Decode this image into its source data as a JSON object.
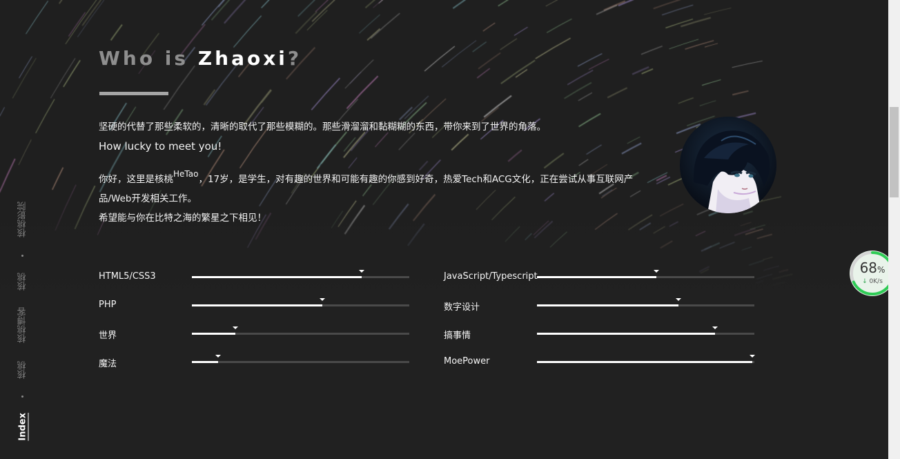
{
  "header": {
    "title_part1": "Who is ",
    "title_name": "Zhaoxi",
    "title_q": "?"
  },
  "intro": {
    "line1": "坚硬的代替了那些柔软的，清晰的取代了那些模糊的。那些滑溜溜和黏糊糊的东西，带你来到了世界的角落。",
    "line2": "How lucky to meet you!",
    "para_prefix": "你好，这里是核桃",
    "para_sup": "HeTao",
    "para_rest": "，17岁，是学生，对有趣的世界和可能有趣的你感到好奇，热爱Tech和ACG文化，正在尝试从事互联网产品/Web开发相关工作。",
    "line_last": "希望能与你在比特之海的繁星之下相见！"
  },
  "sidenav": {
    "items": [
      "核桃影院",
      "核桃",
      "核桃博客",
      "核桃",
      "Index"
    ]
  },
  "skills": [
    {
      "name": "HTML5/CSS3",
      "level": 0.78
    },
    {
      "name": "JavaScript/Typescript",
      "level": 0.55
    },
    {
      "name": "PHP",
      "level": 0.6
    },
    {
      "name": "数字设计",
      "level": 0.65
    },
    {
      "name": "世界",
      "level": 0.2
    },
    {
      "name": "搞事情",
      "level": 0.82
    },
    {
      "name": "魔法",
      "level": 0.12
    },
    {
      "name": "MoePower",
      "level": 0.99
    }
  ],
  "speed_widget": {
    "percent": "68",
    "percent_unit": "%",
    "rate": "0K/s",
    "arrow": "↓",
    "ring_color": "#2ecc55"
  },
  "colors": {
    "background": "#212121",
    "accent_bar": "#a5a5a5"
  }
}
